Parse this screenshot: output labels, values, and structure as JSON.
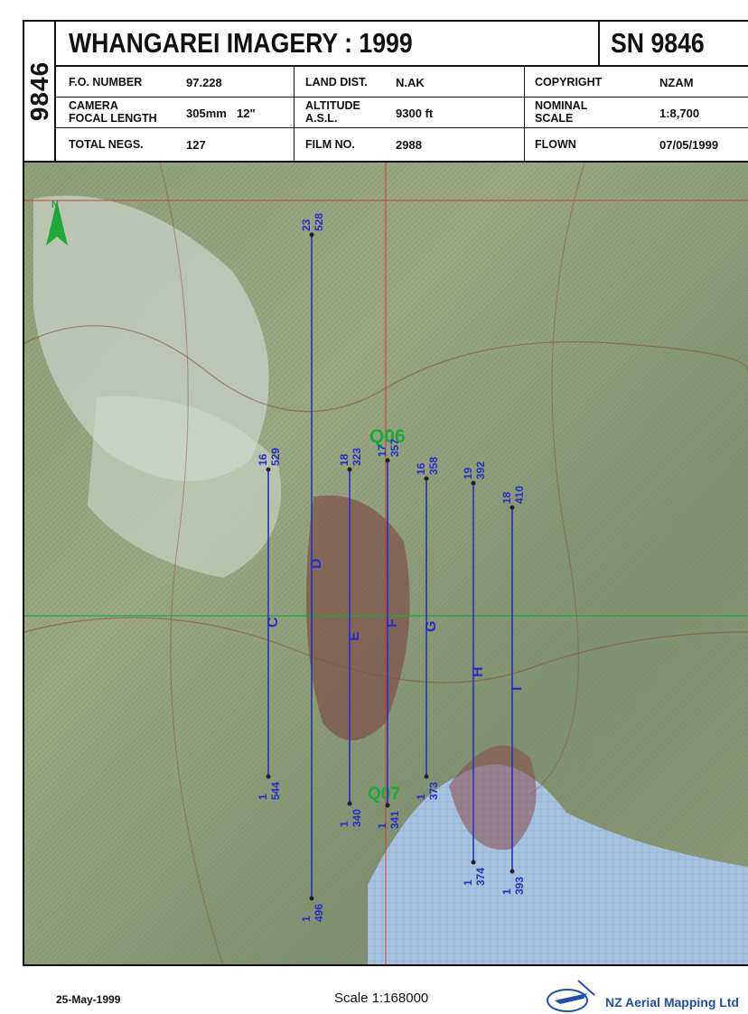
{
  "sheet_code": "9846",
  "title": "WHANGAREI IMAGERY : 1999",
  "sheet_number": "SN 9846",
  "info": {
    "fo_number_label": "F.O. NUMBER",
    "fo_number": "97.228",
    "camera_label_1": "CAMERA",
    "camera_label_2": "FOCAL LENGTH",
    "focal_mm": "305mm",
    "focal_in": "12\"",
    "total_negs_label": "TOTAL NEGS.",
    "total_negs": "127",
    "land_dist_label": "LAND DIST.",
    "land_dist": "N.AK",
    "altitude_label_1": "ALTITUDE",
    "altitude_label_2": "A.S.L.",
    "altitude": "9300 ft",
    "film_no_label": "FILM NO.",
    "film_no": "2988",
    "copyright_label": "COPYRIGHT",
    "copyright": "NZAM",
    "nominal_label_1": "NOMINAL",
    "nominal_label_2": "SCALE",
    "nominal_scale": "1:8,700",
    "flown_label": "FLOWN",
    "flown": "07/05/1999"
  },
  "map": {
    "north_arrow": "north-arrow-icon",
    "colors": {
      "flight_line": "#2430c8",
      "grid_green": "#1fa83a",
      "grid_red": "#d23a3a",
      "sea": "#a8c6e0"
    },
    "sheet_labels": [
      "Q06",
      "Q07"
    ],
    "flight_lines": [
      {
        "id": "C",
        "top_num": "16",
        "top_neg": "529",
        "bottom_num": "1",
        "bottom_neg": "544"
      },
      {
        "id": "D",
        "top_num": "23",
        "top_neg": "528",
        "bottom_num": "1",
        "bottom_neg": "496"
      },
      {
        "id": "E",
        "top_num": "18",
        "top_neg": "323",
        "bottom_num": "1",
        "bottom_neg": "340"
      },
      {
        "id": "F",
        "top_num": "17",
        "top_neg": "357",
        "bottom_num": "1",
        "bottom_neg": "341"
      },
      {
        "id": "G",
        "top_num": "16",
        "top_neg": "358",
        "bottom_num": "1",
        "bottom_neg": "373"
      },
      {
        "id": "H",
        "top_num": "19",
        "top_neg": "392",
        "bottom_num": "1",
        "bottom_neg": "374"
      },
      {
        "id": "I",
        "top_num": "18",
        "top_neg": "410",
        "bottom_num": "1",
        "bottom_neg": "393"
      }
    ]
  },
  "footer": {
    "date": "25-May-1999",
    "scale": "Scale 1:168000",
    "company": "NZ Aerial Mapping Ltd"
  }
}
